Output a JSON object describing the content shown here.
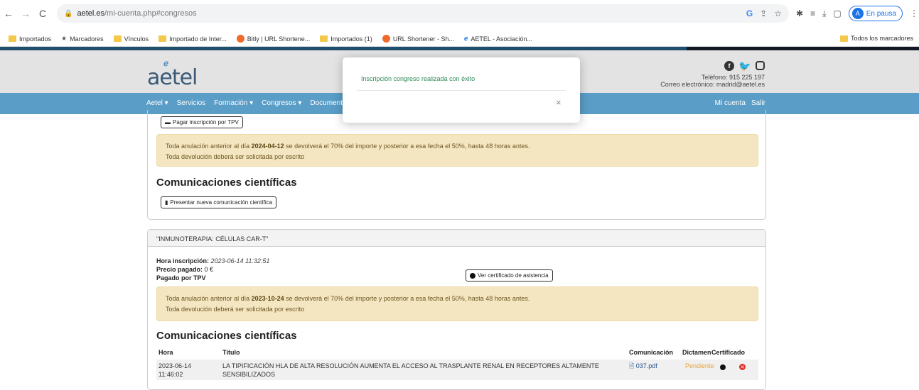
{
  "browser": {
    "url_host": "aetel.es",
    "url_path": "/mi-cuenta.php#congresos",
    "profile_label": "En pausa",
    "bookmarks": [
      {
        "label": "Importados",
        "icon": "folder-icon"
      },
      {
        "label": "Marcadores",
        "icon": "star-icon"
      },
      {
        "label": "Vínculos",
        "icon": "folder-icon"
      },
      {
        "label": "Importado de Inter...",
        "icon": "folder-icon"
      },
      {
        "label": "Bitly | URL Shortene...",
        "icon": "bitly-icon"
      },
      {
        "label": "Importados (1)",
        "icon": "folder-icon"
      },
      {
        "label": "URL Shortener - Sh...",
        "icon": "bitly-icon"
      },
      {
        "label": "AETEL - Asociación...",
        "icon": "aetel-icon"
      }
    ],
    "all_bookmarks": "Todos los marcadores"
  },
  "site": {
    "logo_text": "aetel",
    "phone": "Teléfono: 915 225 197",
    "email": "Correo electrónico: madrid@aetel.es",
    "nav": [
      "Aetel ▾",
      "Servicios",
      "Formación ▾",
      "Congresos ▾",
      "Documento"
    ],
    "nav_right": [
      "Mi cuenta",
      "Salir"
    ]
  },
  "card1": {
    "pay_button": "Pagar inscripción por TPV",
    "warning_pre": "Toda anulación anterior al día ",
    "warning_date": "2024-04-12",
    "warning_post": " se devolverá el 70% del importe y posterior a esa fecha el 50%, hasta 48 horas antes.",
    "warning_line2": "Toda devolución deberá ser solicitada por escrito",
    "section_title": "Comunicaciones científicas",
    "new_comm_button": "Presentar nueva comunicación científica"
  },
  "card2": {
    "title": "\"INMUNOTERAPIA: CÉLULAS CAR-T\"",
    "hora_label": "Hora inscripción:",
    "hora_value": "2023-06-14 11:32:51",
    "precio_label": "Precio pagado:",
    "precio_value": "0 €",
    "pagado_label": "Pagado por TPV",
    "cert_button": "Ver certificado de asistencia",
    "warning_pre": "Toda anulación anterior al día ",
    "warning_date": "2023-10-24",
    "warning_post": " se devolverá el 70% del importe y posterior a esa fecha el 50%, hasta 48 horas antes.",
    "warning_line2": "Toda devolución deberá ser solicitada por escrito",
    "section_title": "Comunicaciones científicas",
    "table": {
      "headers": [
        "Hora",
        "Título",
        "Comunicación",
        "Dictamen",
        "Certificado"
      ],
      "rows": [
        {
          "hora_date": "2023-06-14",
          "hora_time": "11:46:02",
          "titulo_line1": "LA TIPIFICACIÓN HLA DE ALTA RESOLUCIÓN AUMENTA EL ACCESO AL TRASPLANTE RENAL EN RECEPTORES ALTAMENTE",
          "titulo_line2": "SENSIBILIZADOS",
          "comunicacion": "037.pdf",
          "dictamen": "Pendiente"
        }
      ]
    }
  },
  "modal": {
    "message": "Inscripción congreso realizada con éxito",
    "close": "×"
  },
  "colors": {
    "navbar": "#5a9dc6",
    "warning_bg": "#f5e6c2",
    "success_text": "#2e8b57",
    "pending": "#e8a23b"
  }
}
